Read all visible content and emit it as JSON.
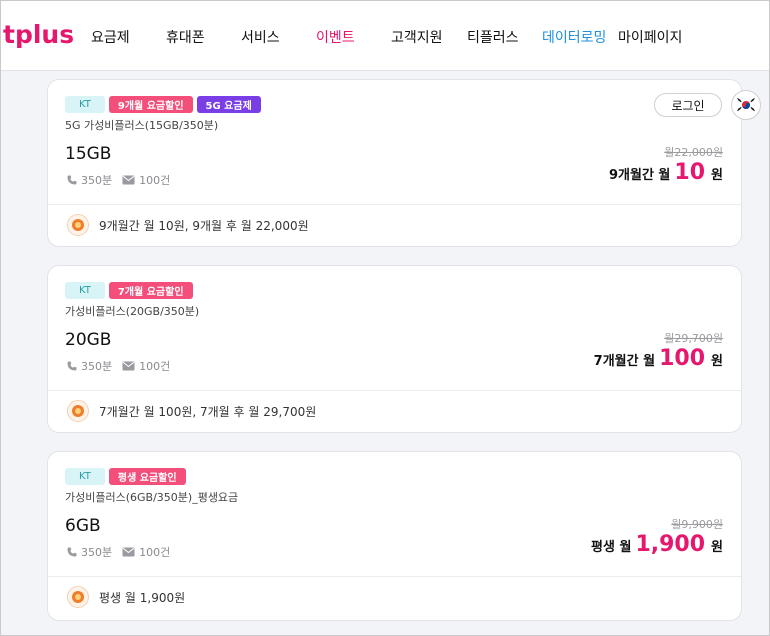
{
  "header": {
    "nav": [
      "요금제",
      "휴대폰",
      "서비스",
      "이벤트",
      "고객지원",
      "티플러스",
      "데이터로밍",
      "마이페이지"
    ],
    "logo_text": "tplus"
  },
  "account": {
    "login_label": "로그인"
  },
  "colors": {
    "brand": "#e5186d",
    "roaming": "#1e8fe0",
    "kt_badge": "#d8f4f6",
    "discount_badge": "#f34f7a",
    "fiveg_badge": "#7a3ee6"
  },
  "plans": [
    {
      "carrier": "KT",
      "discount_badge": "9개월 요금할인",
      "extra_badge": "5G 요금제",
      "name": "5G 가성비플러스(15GB/350분)",
      "data": "15GB",
      "calls": "350분",
      "sms": "100건",
      "original_price": "월22,000원",
      "period_label": "9개월간 월",
      "price": "10",
      "currency": "원",
      "promo": "9개월간 월 10원, 9개월 후 월 22,000원"
    },
    {
      "carrier": "KT",
      "discount_badge": "7개월 요금할인",
      "name": "가성비플러스(20GB/350분)",
      "data": "20GB",
      "calls": "350분",
      "sms": "100건",
      "original_price": "월29,700원",
      "period_label": "7개월간 월",
      "price": "100",
      "currency": "원",
      "promo": "7개월간 월 100원, 7개월 후 월 29,700원"
    },
    {
      "carrier": "KT",
      "discount_badge": "평생 요금할인",
      "name": "가성비플러스(6GB/350분)_평생요금",
      "data": "6GB",
      "calls": "350분",
      "sms": "100건",
      "original_price": "월9,900원",
      "period_label": "평생 월",
      "price": "1,900",
      "currency": "원",
      "promo": "평생 월 1,900원"
    }
  ]
}
